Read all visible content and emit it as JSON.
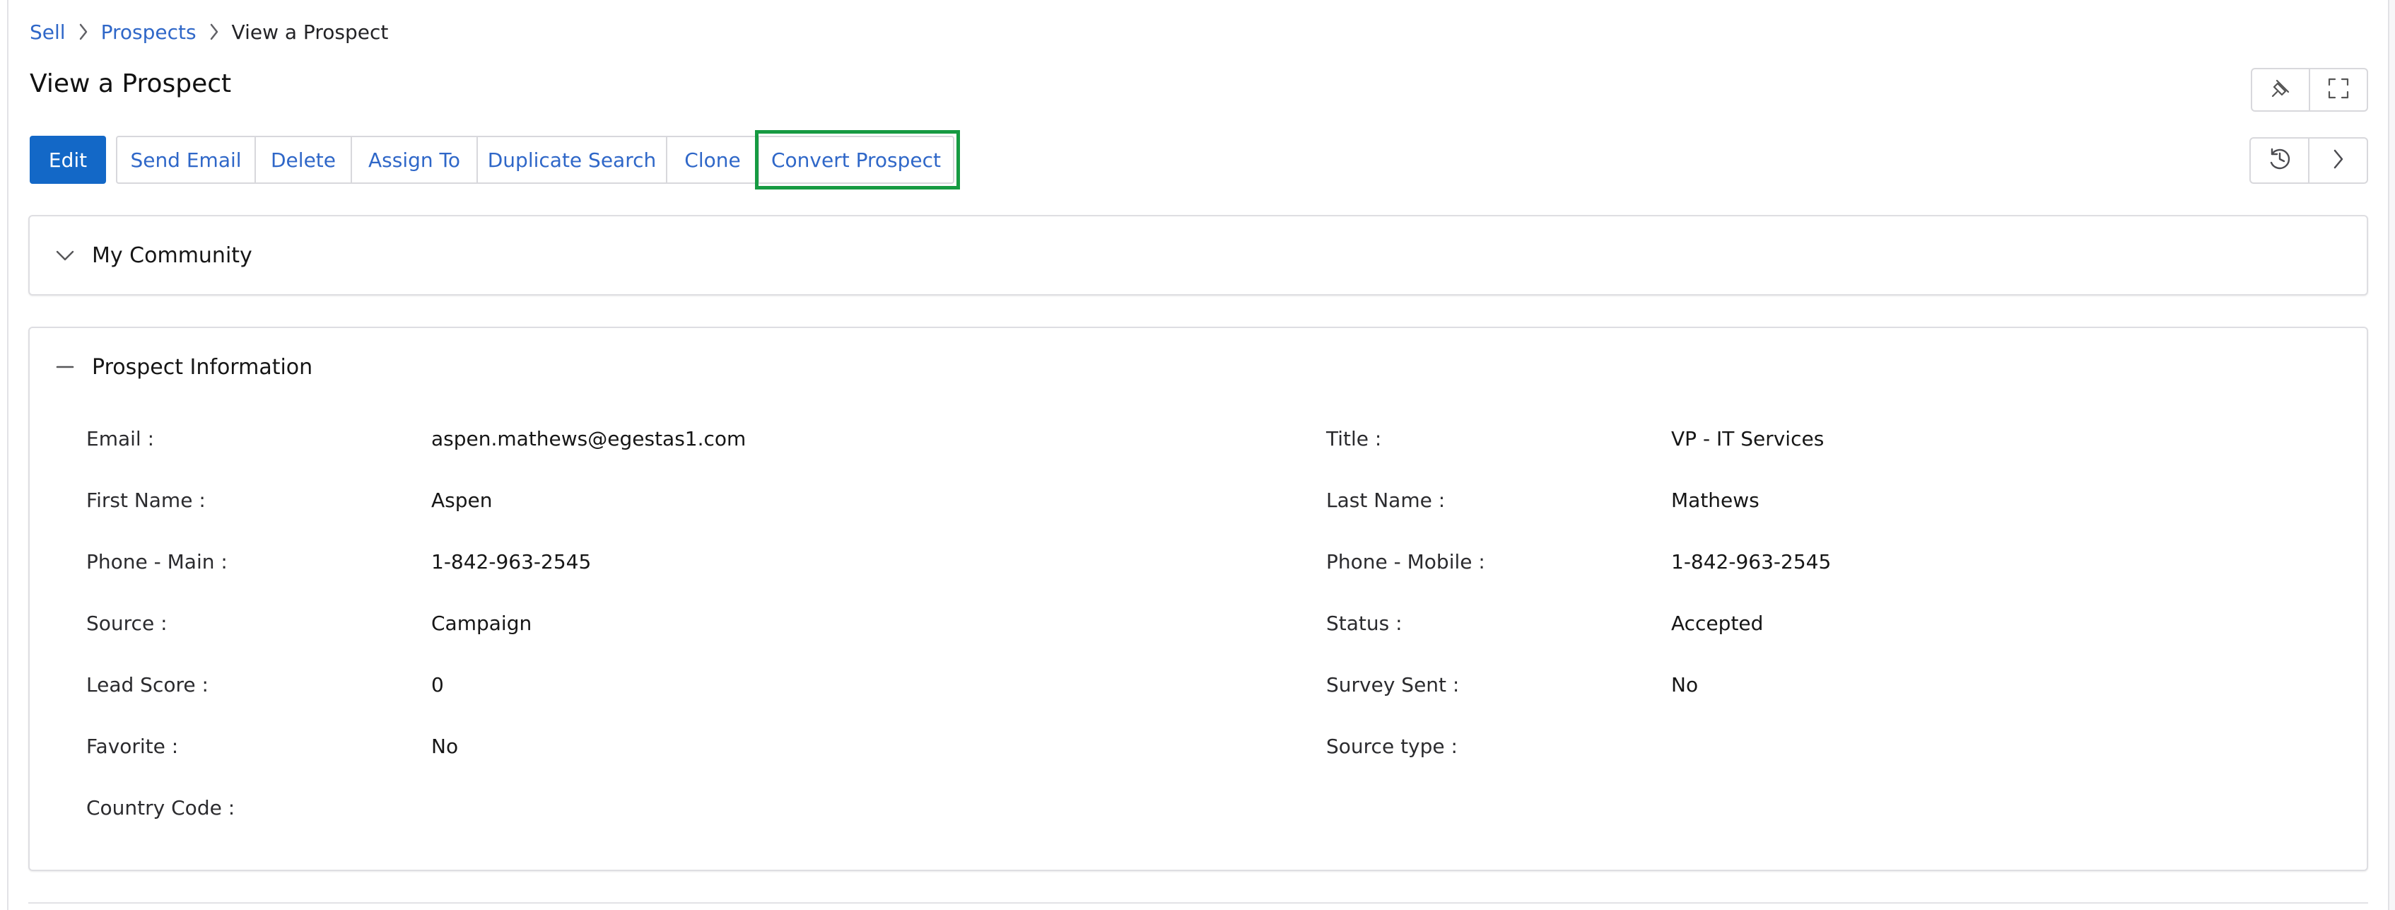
{
  "breadcrumb": {
    "items": [
      "Sell",
      "Prospects",
      "View a Prospect"
    ]
  },
  "page": {
    "title": "View a Prospect"
  },
  "actions": {
    "edit": "Edit",
    "send_email": "Send Email",
    "delete": "Delete",
    "assign_to": "Assign To",
    "duplicate_search": "Duplicate Search",
    "clone": "Clone",
    "convert_prospect": "Convert Prospect"
  },
  "icons": {
    "pin": "pin-icon",
    "expand": "expand-icon",
    "history": "history-icon",
    "next": "chevron-right-icon",
    "breadcrumb_separator": "chevron-right-icon",
    "community_toggle": "chevron-down-icon",
    "info_toggle": "minus-icon"
  },
  "sections": {
    "community": {
      "title": "My Community"
    },
    "prospect_information": {
      "title": "Prospect Information",
      "fields": [
        {
          "label": "Email :",
          "value": "aspen.mathews@egestas1.com"
        },
        {
          "label": "Title :",
          "value": "VP - IT Services"
        },
        {
          "label": "First Name :",
          "value": "Aspen"
        },
        {
          "label": "Last Name :",
          "value": "Mathews"
        },
        {
          "label": "Phone - Main :",
          "value": "1-842-963-2545"
        },
        {
          "label": "Phone - Mobile :",
          "value": "1-842-963-2545"
        },
        {
          "label": "Source :",
          "value": "Campaign"
        },
        {
          "label": "Status :",
          "value": "Accepted"
        },
        {
          "label": "Lead Score :",
          "value": "0"
        },
        {
          "label": "Survey Sent :",
          "value": "No"
        },
        {
          "label": "Favorite :",
          "value": "No"
        },
        {
          "label": "Source type :",
          "value": ""
        },
        {
          "label": "Country Code :",
          "value": ""
        }
      ]
    }
  },
  "colors": {
    "primary": "#1368c7",
    "link": "#2f67c8",
    "highlight": "#169a42",
    "border": "#d8d8dc"
  }
}
